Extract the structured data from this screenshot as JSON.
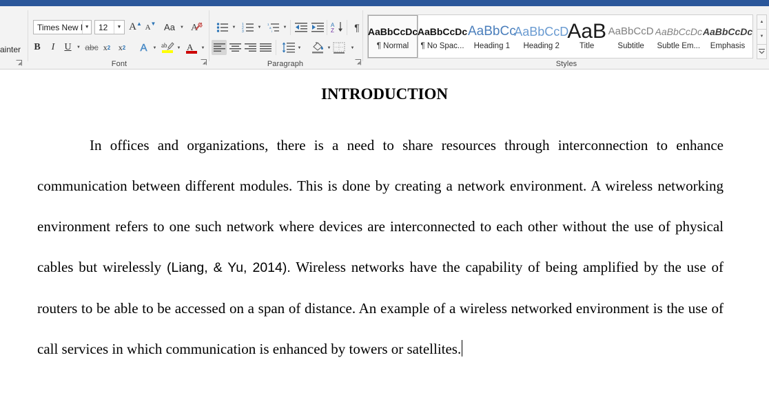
{
  "window": {
    "accent_color": "#2b579a",
    "ribbon_bg": "#f3f3f3"
  },
  "ribbon": {
    "clipboard": {
      "group_label": "",
      "format_painter_label": "ainter",
      "dialog_launcher": "⌐"
    },
    "font": {
      "group_label": "Font",
      "font_name_value": "Times New Ro",
      "font_size_value": "12",
      "grow_font_label": "A",
      "shrink_font_label": "A",
      "change_case_label": "Aa",
      "clear_formatting_label": "clear-formatting",
      "bold_label": "B",
      "italic_label": "I",
      "underline_label": "U",
      "strikethrough_label": "abc",
      "subscript_label": "x",
      "subscript_index": "2",
      "superscript_label": "x",
      "superscript_index": "2",
      "text_effects_label": "A",
      "highlight_label": "ab",
      "highlight_color": "#ffff00",
      "font_color_label": "A",
      "font_color": "#cc0000",
      "dialog_launcher": "⌐"
    },
    "paragraph": {
      "group_label": "Paragraph",
      "bullets_label": "bullets",
      "numbering_label": "numbering",
      "multilevel_label": "multilevel-list",
      "decrease_indent_label": "decrease-indent",
      "increase_indent_label": "increase-indent",
      "sort_label_a": "A",
      "sort_label_z": "Z",
      "show_marks_label": "¶",
      "align_left_label": "align-left",
      "align_center_label": "align-center",
      "align_right_label": "align-right",
      "justify_label": "justify",
      "line_spacing_label": "line-spacing",
      "shading_label": "shading",
      "borders_label": "borders",
      "dialog_launcher": "⌐"
    },
    "styles": {
      "group_label": "Styles",
      "items": [
        {
          "preview": "AaBbCcDc",
          "name": "¶ Normal",
          "selected": true
        },
        {
          "preview": "AaBbCcDc",
          "name": "¶ No Spac...",
          "selected": false
        },
        {
          "preview": "AaBbCc",
          "name": "Heading 1",
          "selected": false
        },
        {
          "preview": "AaBbCcD",
          "name": "Heading 2",
          "selected": false
        },
        {
          "preview": "AaB",
          "name": "Title",
          "selected": false
        },
        {
          "preview": "AaBbCcD",
          "name": "Subtitle",
          "selected": false
        },
        {
          "preview": "AaBbCcDc",
          "name": "Subtle Em...",
          "selected": false
        },
        {
          "preview": "AaBbCcDc",
          "name": "Emphasis",
          "selected": false
        }
      ],
      "scroll_up": "▲",
      "scroll_down": "▼"
    }
  },
  "document": {
    "heading": "INTRODUCTION",
    "paragraph": {
      "part1": "In offices and organizations, there is a need to share resources through interconnection to enhance communication between different modules. This is done by creating a network environment. A wireless networking environment refers to one such network where devices are interconnected to each other without the use of physical cables but wirelessly ",
      "citation": "(Liang, & Yu, 2014).",
      "part2": " Wireless networks have the capability of being amplified by the use of routers to be able to be accessed on a span of distance. An example of a wireless networked environment is the use of call services in which communication is enhanced by towers or satellites."
    }
  }
}
